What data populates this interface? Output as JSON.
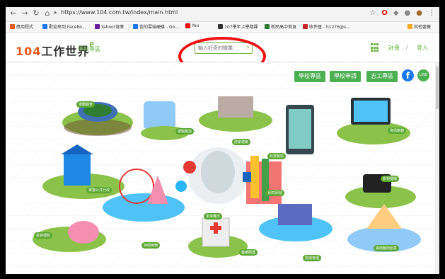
{
  "browser": {
    "url": "https://www.104.com.tw/index/main.html",
    "bookmarks": [
      {
        "label": "應用程式",
        "color": "#e55b1b"
      },
      {
        "label": "歡迎來到 Facebo...",
        "color": "#1877f2"
      },
      {
        "label": "Yahoo!奇摩",
        "color": "#6a1b9a"
      },
      {
        "label": "我的雲端硬碟 - Go...",
        "color": "#1a73e8"
      },
      {
        "label": "You",
        "color": "#e11"
      },
      {
        "label": "107學年上學期課",
        "color": "#333"
      },
      {
        "label": "新民高中首頁",
        "color": "#2e7d32"
      },
      {
        "label": "收件匣 - h1276@s...",
        "color": "#c62828"
      },
      {
        "label": "其他書籤",
        "color": "#f9a825"
      }
    ]
  },
  "header": {
    "logo_num": "104",
    "logo_text": "工作世界",
    "logo_mark": "P",
    "logo_sub": "學校專區",
    "search_placeholder": "輸入好奇的職業",
    "register": "註冊",
    "separator": "/",
    "login": "登入"
  },
  "main": {
    "top_buttons": [
      "學校專區",
      "學校申請",
      "志工專區"
    ],
    "line_label": "LINE",
    "facebook_label": "f",
    "labels": [
      {
        "text": "運動體育"
      },
      {
        "text": "運輸製造"
      },
      {
        "text": "居家建築"
      },
      {
        "text": "科技製造"
      },
      {
        "text": "資訊軟體"
      },
      {
        "text": "軍警公共行政"
      },
      {
        "text": "未來職市"
      },
      {
        "text": "研究研發"
      },
      {
        "text": "影視傳播"
      },
      {
        "text": "投資理財"
      },
      {
        "text": "休閒娛樂"
      },
      {
        "text": "醫療照護"
      },
      {
        "text": "營運管理"
      },
      {
        "text": "美術藝術創意"
      }
    ]
  },
  "colors": {
    "brand_green": "#6cb33f",
    "brand_orange": "#e55b1b",
    "annotation_red": "#e11"
  }
}
